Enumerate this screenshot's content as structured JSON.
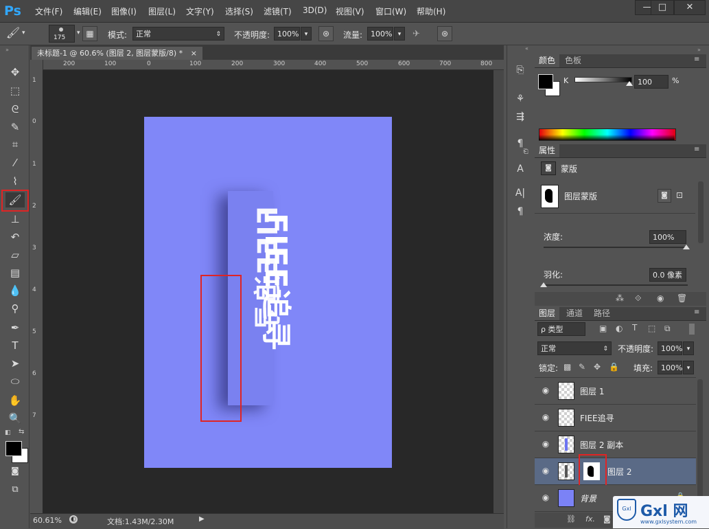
{
  "app": {
    "logo": "Ps"
  },
  "menu": [
    "文件(F)",
    "编辑(E)",
    "图像(I)",
    "图层(L)",
    "文字(Y)",
    "选择(S)",
    "滤镜(T)",
    "3D(D)",
    "视图(V)",
    "窗口(W)",
    "帮助(H)"
  ],
  "window_controls": {
    "minimize": "—",
    "maximize": "□",
    "close": "✕"
  },
  "options": {
    "brush_size": "175",
    "mode_label": "模式:",
    "mode_value": "正常",
    "opacity_label": "不透明度:",
    "opacity_value": "100%",
    "flow_label": "流量:",
    "flow_value": "100%"
  },
  "document": {
    "tab_title": "未标题-1 @ 60.6% (图层 2, 图层蒙版/8) *",
    "tab_close": "×",
    "canvas_color": "#8087f8",
    "text_line1": "FIEE追寻",
    "text_mirror": "FIEE追寻",
    "ruler_top": [
      "200",
      "100",
      "0",
      "100",
      "200",
      "300",
      "400",
      "500",
      "600",
      "700",
      "800"
    ],
    "ruler_left": [
      "1",
      "0",
      "1",
      "2",
      "3",
      "4",
      "5",
      "6",
      "7"
    ]
  },
  "status": {
    "zoom": "60.61%",
    "doc_info": "文档:1.43M/2.30M"
  },
  "color_panel": {
    "tabs": [
      "颜色",
      "色板"
    ],
    "channel": "K",
    "value": "100",
    "unit": "%"
  },
  "properties_panel": {
    "tab": "属性",
    "type": "蒙版",
    "mask_label": "图层蒙版",
    "density_label": "浓度:",
    "density_value": "100%",
    "feather_label": "羽化:",
    "feather_value": "0.0 像素"
  },
  "layers_panel": {
    "tabs": [
      "图层",
      "通道",
      "路径"
    ],
    "filter": "ρ 类型",
    "blend_mode": "正常",
    "opacity_label": "不透明度:",
    "opacity_value": "100%",
    "lock_label": "锁定:",
    "fill_label": "填充:",
    "fill_value": "100%",
    "layers": [
      {
        "name": "图层 1"
      },
      {
        "name": "FIEE追寻"
      },
      {
        "name": "图层 2 副本"
      },
      {
        "name": "图层 2"
      },
      {
        "name": "背景"
      }
    ]
  },
  "watermark": {
    "text": "Gxl 网",
    "url": "www.gxlsystem.com"
  },
  "colors": {
    "highlight": "#e02424",
    "accent": "#31a8ff",
    "selected_layer": "#5a6a86"
  }
}
